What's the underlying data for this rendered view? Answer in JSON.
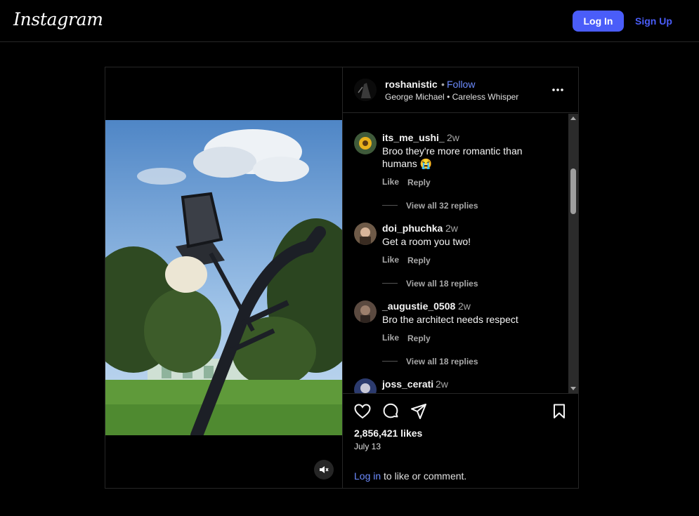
{
  "header": {
    "logo": "Instagram",
    "login_label": "Log In",
    "signup_label": "Sign Up"
  },
  "post": {
    "username": "roshanistic",
    "separator": "•",
    "follow_label": "Follow",
    "audio_artist": "George Michael",
    "audio_separator": "•",
    "audio_song": "Careless Whisper",
    "comments": [
      {
        "user": "its_me_ushi_",
        "time": "2w",
        "text": "Broo they're more romantic than humans 😭",
        "like": "Like",
        "reply": "Reply",
        "view_replies": "View all 32 replies"
      },
      {
        "user": "doi_phuchka",
        "time": "2w",
        "text": "Get a room you two!",
        "like": "Like",
        "reply": "Reply",
        "view_replies": "View all 18 replies"
      },
      {
        "user": "_augustie_0508",
        "time": "2w",
        "text": "Bro the architect needs respect",
        "like": "Like",
        "reply": "Reply",
        "view_replies": "View all 18 replies"
      },
      {
        "user": "joss_cerati",
        "time": "2w"
      }
    ],
    "likes": "2,856,421 likes",
    "date": "July 13",
    "login_prompt_link": "Log in",
    "login_prompt_text": " to like or comment."
  },
  "colors": {
    "accent": "#4a5df9",
    "link": "#6d8cff",
    "background": "#000000",
    "muted": "#a8a8a8"
  },
  "icons": [
    "more-options-icon",
    "heart-icon",
    "comment-icon",
    "share-icon",
    "bookmark-icon",
    "mute-icon"
  ]
}
